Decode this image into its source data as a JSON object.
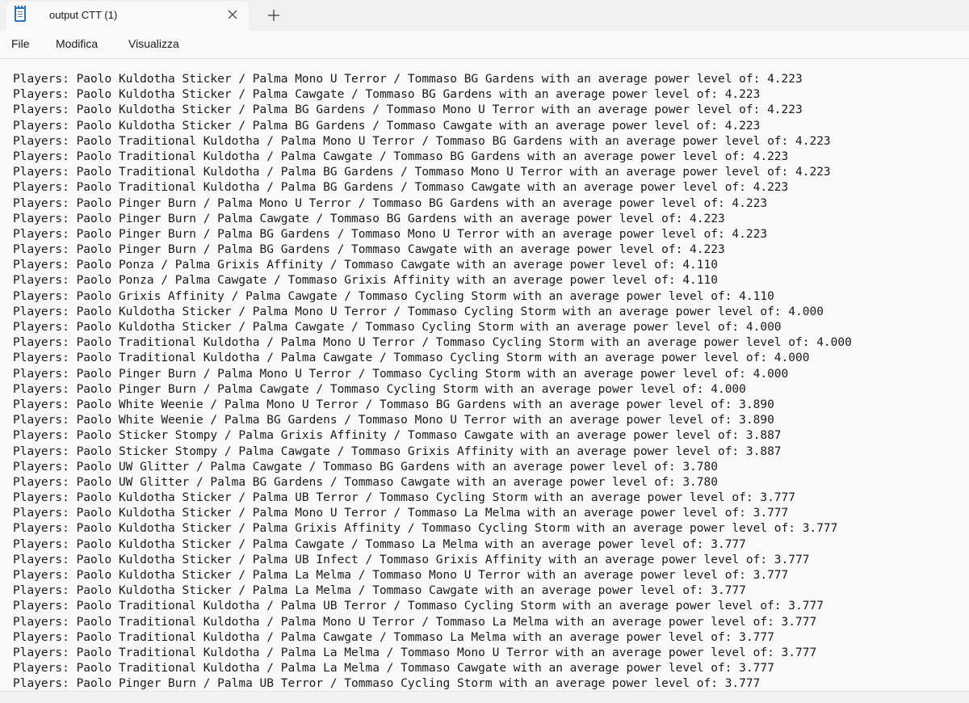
{
  "app": {
    "tab_title": "output CTT (1)",
    "icon": "notepad-icon",
    "close_icon": "close-icon",
    "new_tab_icon": "plus-icon"
  },
  "menu": {
    "file": "File",
    "edit": "Modifica",
    "view": "Visualizza"
  },
  "content": {
    "lines": [
      "Players: Paolo Kuldotha Sticker / Palma Mono U Terror / Tommaso BG Gardens with an average power level of: 4.223",
      "Players: Paolo Kuldotha Sticker / Palma Cawgate / Tommaso BG Gardens with an average power level of: 4.223",
      "Players: Paolo Kuldotha Sticker / Palma BG Gardens / Tommaso Mono U Terror with an average power level of: 4.223",
      "Players: Paolo Kuldotha Sticker / Palma BG Gardens / Tommaso Cawgate with an average power level of: 4.223",
      "Players: Paolo Traditional Kuldotha / Palma Mono U Terror / Tommaso BG Gardens with an average power level of: 4.223",
      "Players: Paolo Traditional Kuldotha / Palma Cawgate / Tommaso BG Gardens with an average power level of: 4.223",
      "Players: Paolo Traditional Kuldotha / Palma BG Gardens / Tommaso Mono U Terror with an average power level of: 4.223",
      "Players: Paolo Traditional Kuldotha / Palma BG Gardens / Tommaso Cawgate with an average power level of: 4.223",
      "Players: Paolo Pinger Burn / Palma Mono U Terror / Tommaso BG Gardens with an average power level of: 4.223",
      "Players: Paolo Pinger Burn / Palma Cawgate / Tommaso BG Gardens with an average power level of: 4.223",
      "Players: Paolo Pinger Burn / Palma BG Gardens / Tommaso Mono U Terror with an average power level of: 4.223",
      "Players: Paolo Pinger Burn / Palma BG Gardens / Tommaso Cawgate with an average power level of: 4.223",
      "Players: Paolo Ponza / Palma Grixis Affinity / Tommaso Cawgate with an average power level of: 4.110",
      "Players: Paolo Ponza / Palma Cawgate / Tommaso Grixis Affinity with an average power level of: 4.110",
      "Players: Paolo Grixis Affinity / Palma Cawgate / Tommaso Cycling Storm with an average power level of: 4.110",
      "Players: Paolo Kuldotha Sticker / Palma Mono U Terror / Tommaso Cycling Storm with an average power level of: 4.000",
      "Players: Paolo Kuldotha Sticker / Palma Cawgate / Tommaso Cycling Storm with an average power level of: 4.000",
      "Players: Paolo Traditional Kuldotha / Palma Mono U Terror / Tommaso Cycling Storm with an average power level of: 4.000",
      "Players: Paolo Traditional Kuldotha / Palma Cawgate / Tommaso Cycling Storm with an average power level of: 4.000",
      "Players: Paolo Pinger Burn / Palma Mono U Terror / Tommaso Cycling Storm with an average power level of: 4.000",
      "Players: Paolo Pinger Burn / Palma Cawgate / Tommaso Cycling Storm with an average power level of: 4.000",
      "Players: Paolo White Weenie / Palma Mono U Terror / Tommaso BG Gardens with an average power level of: 3.890",
      "Players: Paolo White Weenie / Palma BG Gardens / Tommaso Mono U Terror with an average power level of: 3.890",
      "Players: Paolo Sticker Stompy / Palma Grixis Affinity / Tommaso Cawgate with an average power level of: 3.887",
      "Players: Paolo Sticker Stompy / Palma Cawgate / Tommaso Grixis Affinity with an average power level of: 3.887",
      "Players: Paolo UW Glitter / Palma Cawgate / Tommaso BG Gardens with an average power level of: 3.780",
      "Players: Paolo UW Glitter / Palma BG Gardens / Tommaso Cawgate with an average power level of: 3.780",
      "Players: Paolo Kuldotha Sticker / Palma UB Terror / Tommaso Cycling Storm with an average power level of: 3.777",
      "Players: Paolo Kuldotha Sticker / Palma Mono U Terror / Tommaso La Melma with an average power level of: 3.777",
      "Players: Paolo Kuldotha Sticker / Palma Grixis Affinity / Tommaso Cycling Storm with an average power level of: 3.777",
      "Players: Paolo Kuldotha Sticker / Palma Cawgate / Tommaso La Melma with an average power level of: 3.777",
      "Players: Paolo Kuldotha Sticker / Palma UB Infect / Tommaso Grixis Affinity with an average power level of: 3.777",
      "Players: Paolo Kuldotha Sticker / Palma La Melma / Tommaso Mono U Terror with an average power level of: 3.777",
      "Players: Paolo Kuldotha Sticker / Palma La Melma / Tommaso Cawgate with an average power level of: 3.777",
      "Players: Paolo Traditional Kuldotha / Palma UB Terror / Tommaso Cycling Storm with an average power level of: 3.777",
      "Players: Paolo Traditional Kuldotha / Palma Mono U Terror / Tommaso La Melma with an average power level of: 3.777",
      "Players: Paolo Traditional Kuldotha / Palma Cawgate / Tommaso La Melma with an average power level of: 3.777",
      "Players: Paolo Traditional Kuldotha / Palma La Melma / Tommaso Mono U Terror with an average power level of: 3.777",
      "Players: Paolo Traditional Kuldotha / Palma La Melma / Tommaso Cawgate with an average power level of: 3.777",
      "Players: Paolo Pinger Burn / Palma UB Terror / Tommaso Cycling Storm with an average power level of: 3.777"
    ]
  }
}
